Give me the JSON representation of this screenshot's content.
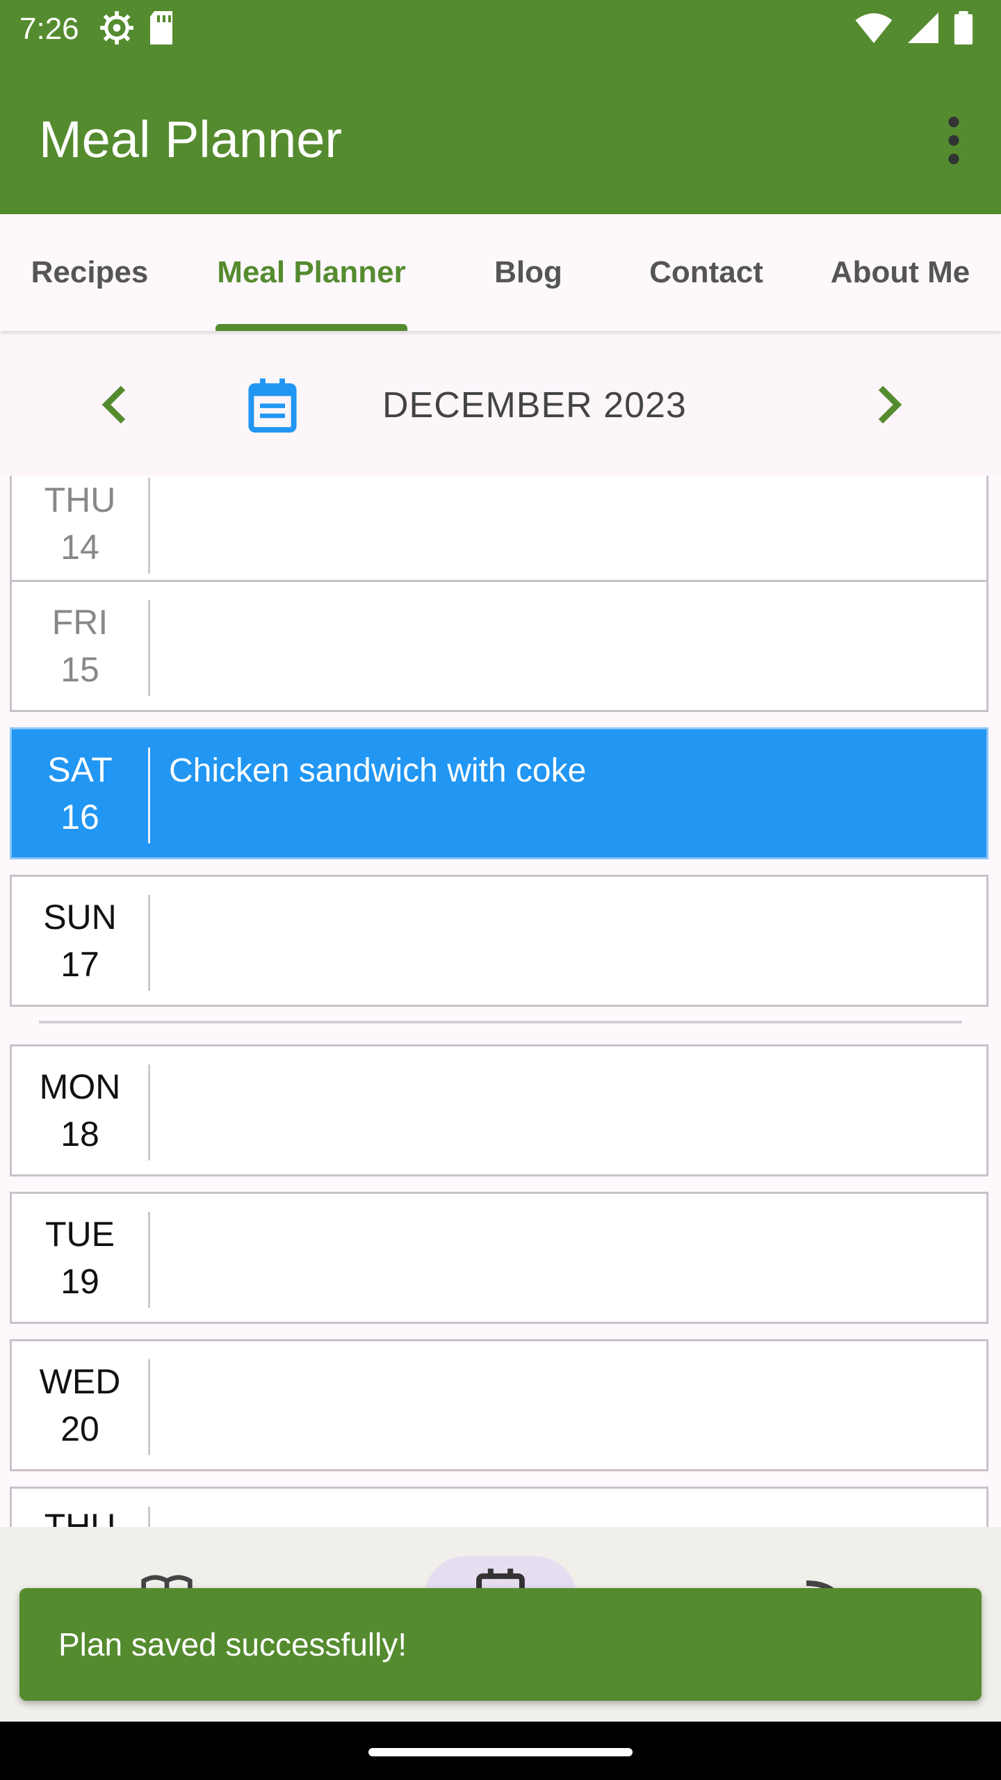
{
  "status_bar": {
    "time": "7:26",
    "left_icons": [
      "settings-icon",
      "sd-card-icon"
    ],
    "right_icons": [
      "wifi-icon",
      "cell-signal-icon",
      "battery-icon"
    ]
  },
  "app_bar": {
    "title": "Meal Planner",
    "menu_icon": "more-vert-icon"
  },
  "tabs": [
    {
      "label": "Recipes",
      "active": false
    },
    {
      "label": "Meal Planner",
      "active": true
    },
    {
      "label": "Blog",
      "active": false
    },
    {
      "label": "Contact",
      "active": false
    },
    {
      "label": "About Me",
      "active": false
    }
  ],
  "month_nav": {
    "label": "DECEMBER 2023",
    "prev_icon": "chevron-left-icon",
    "next_icon": "chevron-right-icon",
    "calendar_icon": "calendar-icon"
  },
  "days": [
    {
      "day": "THU",
      "date": "14",
      "meal": "",
      "selected": false,
      "muted": true
    },
    {
      "day": "FRI",
      "date": "15",
      "meal": "",
      "selected": false,
      "muted": true
    },
    {
      "day": "SAT",
      "date": "16",
      "meal": "Chicken sandwich with coke",
      "selected": true,
      "muted": false
    },
    {
      "day": "SUN",
      "date": "17",
      "meal": "",
      "selected": false,
      "muted": false
    },
    {
      "day": "MON",
      "date": "18",
      "meal": "",
      "selected": false,
      "muted": false
    },
    {
      "day": "TUE",
      "date": "19",
      "meal": "",
      "selected": false,
      "muted": false
    },
    {
      "day": "WED",
      "date": "20",
      "meal": "",
      "selected": false,
      "muted": false
    },
    {
      "day": "THU",
      "date": "",
      "meal": "",
      "selected": false,
      "muted": false
    }
  ],
  "snackbar": {
    "message": "Plan saved successfully!"
  },
  "colors": {
    "primary": "#558b2f",
    "selected": "#2196f3",
    "calendar_icon": "#2196f3"
  }
}
